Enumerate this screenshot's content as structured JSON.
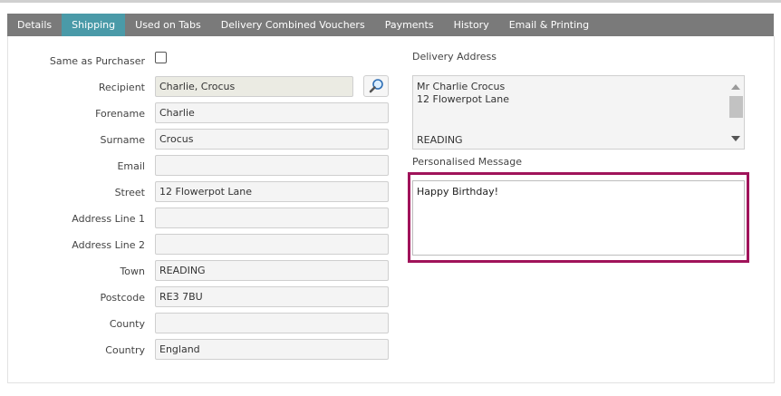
{
  "tabs": [
    {
      "label": "Details"
    },
    {
      "label": "Shipping"
    },
    {
      "label": "Used on Tabs"
    },
    {
      "label": "Delivery Combined Vouchers"
    },
    {
      "label": "Payments"
    },
    {
      "label": "History"
    },
    {
      "label": "Email & Printing"
    }
  ],
  "active_tab": "Shipping",
  "form": {
    "same_as_purchaser_label": "Same as Purchaser",
    "same_as_purchaser_checked": false,
    "recipient_label": "Recipient",
    "recipient_value": "Charlie, Crocus",
    "forename_label": "Forename",
    "forename_value": "Charlie",
    "surname_label": "Surname",
    "surname_value": "Crocus",
    "email_label": "Email",
    "email_value": "",
    "street_label": "Street",
    "street_value": "12 Flowerpot Lane",
    "address1_label": "Address Line 1",
    "address1_value": "",
    "address2_label": "Address Line 2",
    "address2_value": "",
    "town_label": "Town",
    "town_value": "READING",
    "postcode_label": "Postcode",
    "postcode_value": "RE3 7BU",
    "county_label": "County",
    "county_value": "",
    "country_label": "Country",
    "country_value": "England"
  },
  "delivery": {
    "label": "Delivery Address",
    "lines": [
      "Mr Charlie Crocus",
      "12 Flowerpot Lane",
      "READING"
    ]
  },
  "message": {
    "label": "Personalised Message",
    "value": "Happy Birthday!"
  },
  "colors": {
    "tabbar": "#7a7a7a",
    "active_tab": "#4a9aa8",
    "highlight": "#a0135a"
  },
  "icons": {
    "lookup": "magnifier-icon",
    "scroll_up": "triangle-up-icon",
    "scroll_down": "triangle-down-icon"
  }
}
